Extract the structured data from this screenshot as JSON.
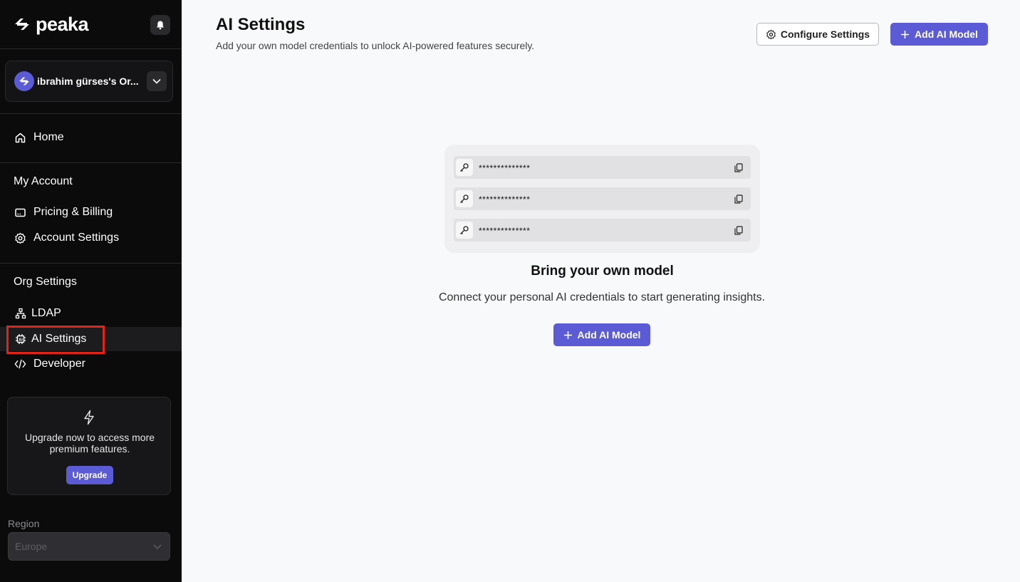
{
  "brand": {
    "name": "peaka"
  },
  "org": {
    "name": "ibrahim gürses's Or..."
  },
  "nav": {
    "home": "Home",
    "my_account": "My Account",
    "pricing": "Pricing & Billing",
    "account_settings": "Account Settings",
    "org_settings": "Org Settings",
    "ldap": "LDAP",
    "ai_settings": "AI Settings",
    "developer": "Developer"
  },
  "upgrade": {
    "text": "Upgrade now to access more premium features.",
    "button": "Upgrade"
  },
  "region": {
    "label": "Region",
    "value": "Europe"
  },
  "header": {
    "title": "AI Settings",
    "subtitle": "Add your own model credentials to unlock AI-powered features securely.",
    "configure_label": "Configure Settings",
    "add_model_label": "Add AI Model"
  },
  "keys": [
    {
      "mask": "**************"
    },
    {
      "mask": "**************"
    },
    {
      "mask": "**************"
    }
  ],
  "empty_state": {
    "title": "Bring your own model",
    "description": "Connect your personal AI credentials to start generating insights.",
    "button": "Add AI Model"
  },
  "colors": {
    "accent": "#5b5bd6",
    "sidebar_bg": "#0b0b0c",
    "highlight": "#e2231a"
  }
}
